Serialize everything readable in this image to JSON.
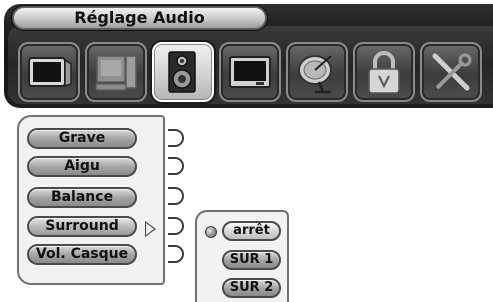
{
  "header": {
    "title": "Réglage Audio"
  },
  "toolbar": {
    "icons": [
      {
        "name": "tv-icon",
        "selected": false
      },
      {
        "name": "computer-icon",
        "selected": false
      },
      {
        "name": "speaker-icon",
        "selected": true
      },
      {
        "name": "screen-icon",
        "selected": false
      },
      {
        "name": "satellite-dish-icon",
        "selected": false
      },
      {
        "name": "padlock-icon",
        "selected": false
      },
      {
        "name": "tools-icon",
        "selected": false
      }
    ]
  },
  "menu": {
    "items": [
      {
        "label": "Grave"
      },
      {
        "label": "Aigu"
      },
      {
        "label": "Balance"
      },
      {
        "label": "Surround",
        "active": true
      },
      {
        "label": "Vol. Casque"
      }
    ]
  },
  "submenu": {
    "options": [
      {
        "label": "arrêt",
        "selected": true
      },
      {
        "label": "SUR 1"
      },
      {
        "label": "SUR 2"
      }
    ]
  }
}
